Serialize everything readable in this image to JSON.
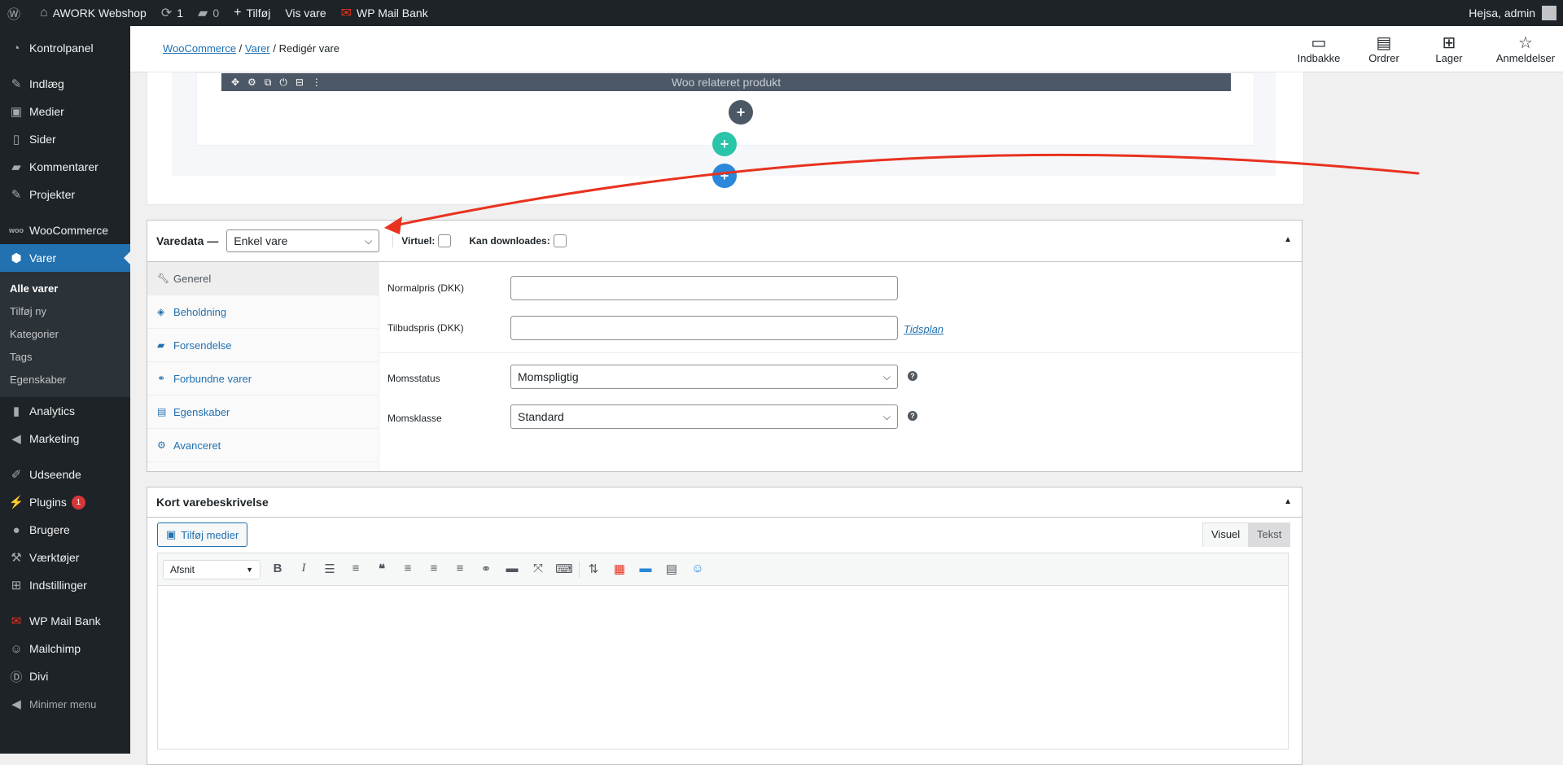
{
  "adminbar": {
    "site_name": "AWORK Webshop",
    "updates_count": "1",
    "comments_count": "0",
    "new_label": "Tilføj",
    "view_label": "Vis vare",
    "mailbank_label": "WP Mail Bank",
    "greeting": "Hejsa, admin"
  },
  "sidebar": {
    "items": [
      {
        "label": "Kontrolpanel",
        "icon": "dashboard-icon"
      },
      {
        "label": "Indlæg",
        "icon": "pin-icon"
      },
      {
        "label": "Medier",
        "icon": "media-icon"
      },
      {
        "label": "Sider",
        "icon": "page-icon"
      },
      {
        "label": "Kommentarer",
        "icon": "comment-icon"
      },
      {
        "label": "Projekter",
        "icon": "pin-icon"
      },
      {
        "label": "WooCommerce",
        "icon": "woo-icon"
      },
      {
        "label": "Varer",
        "icon": "box-icon"
      },
      {
        "label": "Analytics",
        "icon": "chart-icon"
      },
      {
        "label": "Marketing",
        "icon": "megaphone-icon"
      },
      {
        "label": "Udseende",
        "icon": "brush-icon"
      },
      {
        "label": "Plugins",
        "icon": "plug-icon",
        "badge": "1"
      },
      {
        "label": "Brugere",
        "icon": "user-icon"
      },
      {
        "label": "Værktøjer",
        "icon": "wrench-icon"
      },
      {
        "label": "Indstillinger",
        "icon": "settings-icon"
      },
      {
        "label": "WP Mail Bank",
        "icon": "mail-icon"
      },
      {
        "label": "Mailchimp",
        "icon": "mailchimp-icon"
      },
      {
        "label": "Divi",
        "icon": "divi-icon"
      },
      {
        "label": "Minimer menu",
        "icon": "collapse-icon"
      }
    ],
    "submenu": [
      "Alle varer",
      "Tilføj ny",
      "Kategorier",
      "Tags",
      "Egenskaber"
    ]
  },
  "wcbar": {
    "breadcrumb": [
      "WooCommerce",
      "Varer",
      "Redigér vare"
    ],
    "actions": [
      "Indbakke",
      "Ordrer",
      "Lager",
      "Anmeldelser"
    ]
  },
  "builder": {
    "module_title": "Woo relateret produkt"
  },
  "product_data": {
    "title": "Varedata —",
    "type_value": "Enkel vare",
    "virtual_label": "Virtuel:",
    "download_label": "Kan downloades:",
    "tabs": [
      "Generel",
      "Beholdning",
      "Forsendelse",
      "Forbundne varer",
      "Egenskaber",
      "Avanceret"
    ],
    "regular_price_label": "Normalpris (DKK)",
    "sale_price_label": "Tilbudspris (DKK)",
    "schedule_link": "Tidsplan",
    "tax_status_label": "Momsstatus",
    "tax_status_value": "Momspligtig",
    "tax_class_label": "Momsklasse",
    "tax_class_value": "Standard"
  },
  "short_desc": {
    "title": "Kort varebeskrivelse",
    "add_media": "Tilføj medier",
    "tab_visual": "Visuel",
    "tab_text": "Tekst",
    "format_value": "Afsnit"
  },
  "colors": {
    "accent": "#2271b1",
    "admin_dark": "#1d2327",
    "annotation_red": "#e8321f"
  }
}
